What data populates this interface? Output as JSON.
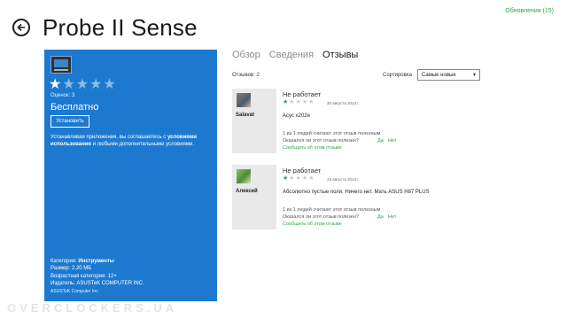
{
  "header": {
    "title": "Probe II Sense",
    "updates_link": "Обновления (15)"
  },
  "app_panel": {
    "rating_stars": 1,
    "rating_max": 5,
    "rating_label": "Оценок: 3",
    "price": "Бесплатно",
    "install_label": "Установить",
    "terms_prefix": "Устанавливая приложения, вы соглашаетесь с ",
    "terms_link": "условиями использования",
    "terms_suffix": " и любыми дополнительными условиями.",
    "meta": {
      "category_label": "Категория:",
      "category_value": "Инструменты",
      "size": "Размер: 2,20 МБ",
      "age": "Возрастная категория: 12+",
      "publisher": "Издатель: ASUSTeK COMPUTER INC.",
      "copyright": "ASUSTeK Computer Inc."
    }
  },
  "tabs": [
    {
      "label": "Обзор",
      "active": false
    },
    {
      "label": "Сведения",
      "active": false
    },
    {
      "label": "Отзывы",
      "active": true
    }
  ],
  "reviews_header": {
    "count_label": "Отзывов: 2",
    "sort_label": "Сортировка",
    "sort_value": "Самые новые"
  },
  "reviews": [
    {
      "author": "Salavat",
      "title": "Не работает",
      "stars": 1,
      "date": "30 августа 2013 г.",
      "text": "Асус х202е",
      "helpful_count": "1 из 1 людей считают этот отзыв полезным",
      "helpful_question": "Оказался ли этот отзыв полезен?",
      "yes": "Да",
      "no": "Нет",
      "report": "Сообщить об этом отзыве"
    },
    {
      "author": "Алексей",
      "title": "Не работает",
      "stars": 1,
      "date": "29 августа 2013 г.",
      "text": "Абсолютно пустые поля. Ничего нет. Мать ASUS H87 PLUS",
      "helpful_count": "1 из 1 людей считают этот отзыв полезным",
      "helpful_question": "Оказался ли этот отзыв полезен?",
      "yes": "Да",
      "no": "Нет",
      "report": "Сообщить об этом отзыве"
    }
  ],
  "watermark": "OVERCLOCKERS.UA",
  "colors": {
    "panel_blue": "#1d79d0",
    "accent_green": "#2fa34c"
  }
}
